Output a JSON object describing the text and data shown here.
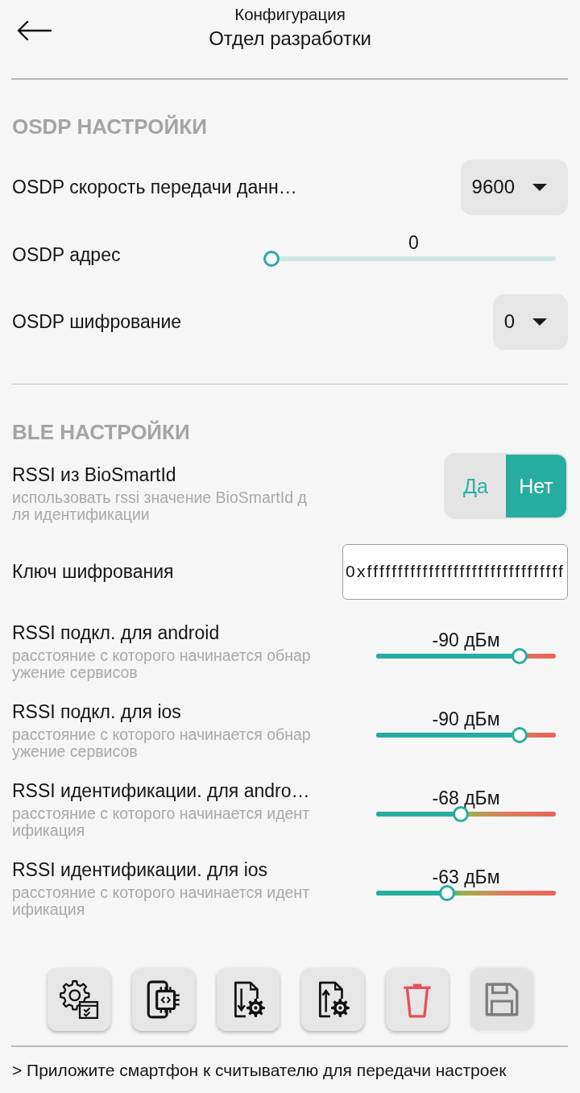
{
  "header": {
    "title": "Конфигурация",
    "subtitle": "Отдел разработки"
  },
  "sections": [
    {
      "heading": "OSDP НАСТРОЙКИ",
      "rows": [
        {
          "kind": "dropdown",
          "label": "OSDP скорость передачи данн…",
          "value": "9600"
        },
        {
          "kind": "slider",
          "label": "OSDP адрес",
          "reading": "0",
          "level": 0
        },
        {
          "kind": "dropdown",
          "label": "OSDP шифрование",
          "value": "0"
        }
      ]
    },
    {
      "heading": "BLE НАСТРОЙКИ",
      "rows": [
        {
          "kind": "toggle",
          "label": "RSSI из BioSmartId",
          "description": "использовать rssi значение BioSmartId для идентификации",
          "options": [
            {
              "label": "Да",
              "selected": false
            },
            {
              "label": "Нет",
              "selected": true
            }
          ]
        },
        {
          "kind": "text_field",
          "label": "Ключ шифрования",
          "value": "0xffffffffffffffffffffffffffffffff"
        },
        {
          "kind": "rssi_slider",
          "label": "RSSI подкл. для android",
          "description": "расстояние с которого начинается обнаружение сервисов",
          "reading": "-90 дБм",
          "level": 0.8
        },
        {
          "kind": "rssi_slider",
          "label": "RSSI подкл. для ios",
          "description": "расстояние с которого начинается обнаружение сервисов",
          "reading": "-90 дБм",
          "level": 0.8
        },
        {
          "kind": "rssi_slider",
          "label": "RSSI идентификации. для andro…",
          "description": "расстояние с которого начинается идентификация",
          "reading": "-68 дБм",
          "level": 0.47
        },
        {
          "kind": "rssi_slider",
          "label": "RSSI идентификации. для ios",
          "description": "расстояние с которого начинается идентификация",
          "reading": "-63 дБм",
          "level": 0.395
        }
      ]
    }
  ],
  "toolbar": [
    {
      "kind": "gear_checklist",
      "disabled": false
    },
    {
      "kind": "phone_chip",
      "disabled": false
    },
    {
      "kind": "doc_down_gear",
      "disabled": false
    },
    {
      "kind": "doc_up_gear",
      "disabled": false
    },
    {
      "kind": "trash",
      "disabled": false
    },
    {
      "kind": "floppy",
      "disabled": true
    }
  ],
  "status_bar": "> Приложите смартфон к считывателю для передачи настроек"
}
